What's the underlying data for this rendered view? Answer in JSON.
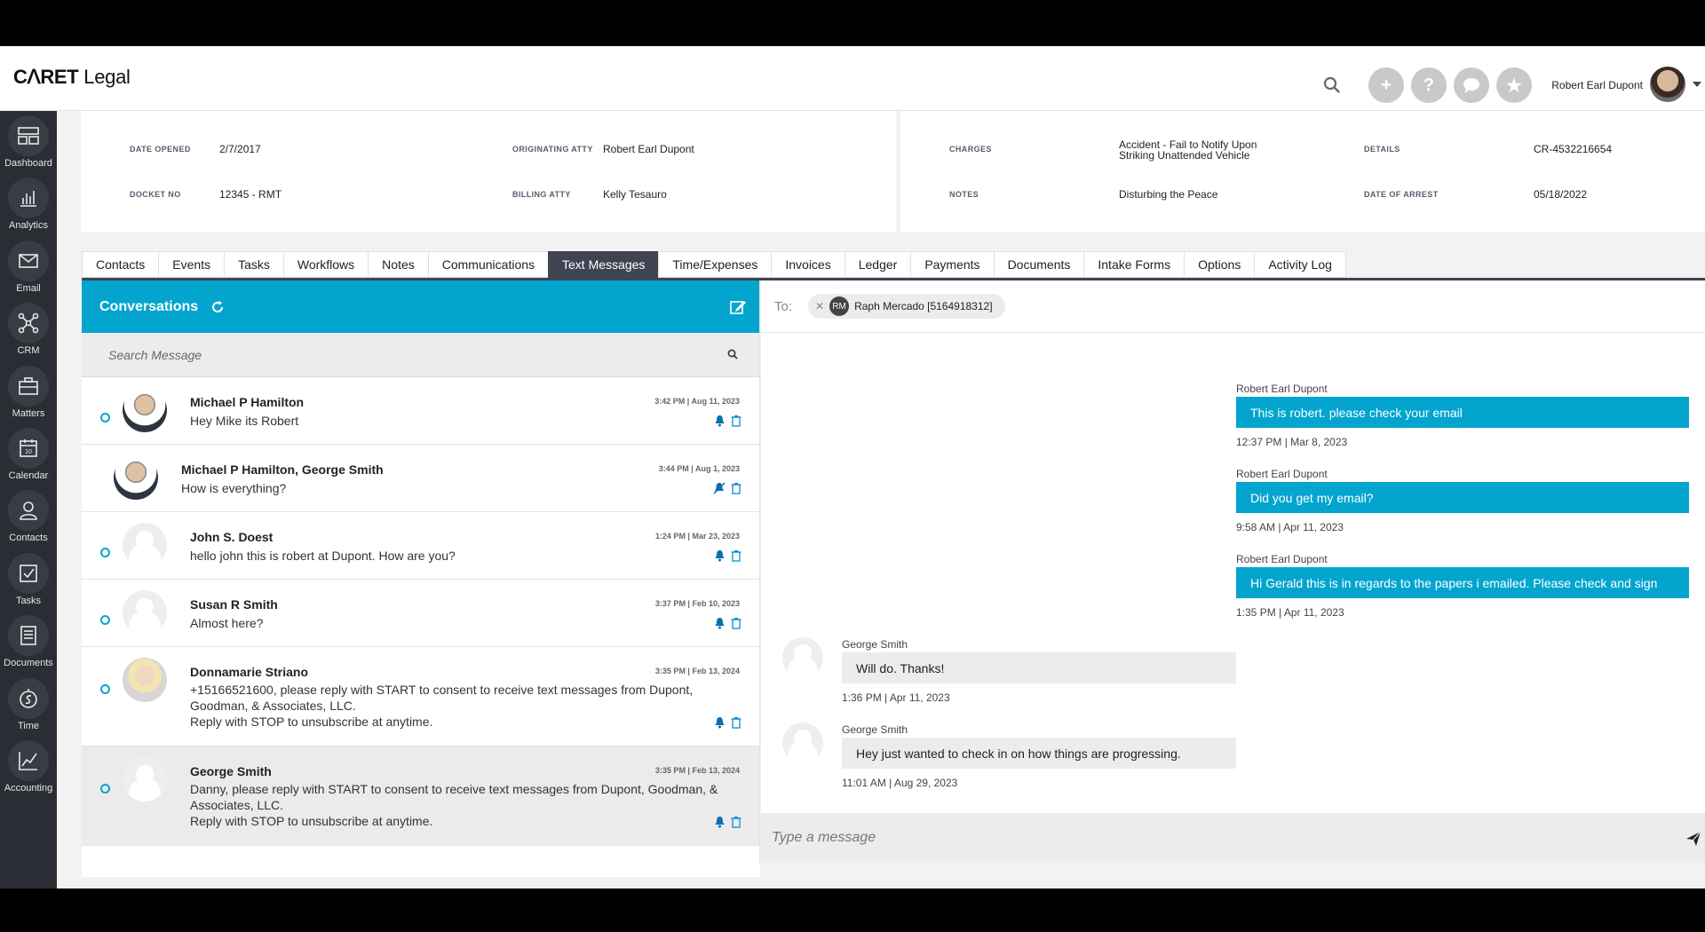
{
  "app": {
    "logo_prefix": "CᐱRET",
    "logo_suffix": "Legal",
    "user_name": "Robert Earl Dupont"
  },
  "header_icons": {
    "add": "+",
    "help": "?",
    "chat": "chat-icon",
    "star": "★"
  },
  "sidebar": {
    "items": [
      {
        "label": "Dashboard",
        "icon": "dashboard-icon"
      },
      {
        "label": "Analytics",
        "icon": "analytics-icon"
      },
      {
        "label": "Email",
        "icon": "email-icon"
      },
      {
        "label": "CRM",
        "icon": "crm-icon"
      },
      {
        "label": "Matters",
        "icon": "matters-icon"
      },
      {
        "label": "Calendar",
        "icon": "calendar-icon"
      },
      {
        "label": "Contacts",
        "icon": "contacts-icon"
      },
      {
        "label": "Tasks",
        "icon": "tasks-icon"
      },
      {
        "label": "Documents",
        "icon": "documents-icon"
      },
      {
        "label": "Time",
        "icon": "time-icon"
      },
      {
        "label": "Accounting",
        "icon": "accounting-icon"
      }
    ],
    "calendar_day": "10"
  },
  "matter": {
    "date_opened_label": "DATE OPENED",
    "date_opened": "2/7/2017",
    "originating_atty_label": "ORIGINATING ATTY",
    "originating_atty": "Robert Earl Dupont",
    "docket_no_label": "DOCKET NO",
    "docket_no": "12345 - RMT",
    "billing_atty_label": "BILLING ATTY",
    "billing_atty": "Kelly Tesauro",
    "charges_label": "CHARGES",
    "charges_line1": "Accident - Fail to Notify Upon",
    "charges_line2": "Striking Unattended Vehicle",
    "details_label": "DETAILS",
    "details": "CR-4532216654",
    "notes_label": "NOTES",
    "notes": "Disturbing the Peace",
    "date_of_arrest_label": "DATE OF ARREST",
    "date_of_arrest": "05/18/2022"
  },
  "tabs": [
    "Contacts",
    "Events",
    "Tasks",
    "Workflows",
    "Notes",
    "Communications",
    "Text Messages",
    "Time/Expenses",
    "Invoices",
    "Ledger",
    "Payments",
    "Documents",
    "Intake Forms",
    "Options",
    "Activity Log"
  ],
  "active_tab": "Text Messages",
  "conversations": {
    "title": "Conversations",
    "search_placeholder": "Search Message",
    "items": [
      {
        "name": "Michael P Hamilton",
        "time": "3:42 PM | Aug 11, 2023",
        "msg1": "Hey Mike its Robert",
        "msg2": "",
        "msg3": ""
      },
      {
        "name": "Michael P Hamilton, George Smith",
        "time": "3:44 PM | Aug 1, 2023",
        "msg1": "How is everything?",
        "msg2": "",
        "msg3": ""
      },
      {
        "name": "John S. Doest",
        "time": "1:24 PM | Mar 23, 2023",
        "msg1": "hello john this is robert at Dupont. How are you?",
        "msg2": "",
        "msg3": ""
      },
      {
        "name": "Susan R Smith",
        "time": "3:37 PM | Feb 10, 2023",
        "msg1": "Almost here?",
        "msg2": "",
        "msg3": ""
      },
      {
        "name": "Donnamarie Striano",
        "time": "3:35 PM | Feb 13, 2024",
        "msg1": "+15166521600, please reply with START to consent to receive text messages from Dupont,",
        "msg2": "Goodman, & Associates, LLC.",
        "msg3": "Reply with STOP to unsubscribe at anytime."
      },
      {
        "name": "George Smith",
        "time": "3:35 PM | Feb 13, 2024",
        "msg1": "Danny, please reply with START to consent to receive text messages from Dupont, Goodman, &",
        "msg2": "Associates, LLC.",
        "msg3": "Reply with STOP to unsubscribe at anytime."
      }
    ]
  },
  "chat": {
    "to_label": "To:",
    "recipient_initials": "RM",
    "recipient": "Raph Mercado [5164918312]",
    "messages": [
      {
        "sender": "Robert Earl Dupont",
        "text": "This is robert. please check your email",
        "time": "12:37 PM | Mar 8, 2023"
      },
      {
        "sender": "Robert Earl Dupont",
        "text": "Did you get my email?",
        "time": "9:58 AM | Apr 11, 2023"
      },
      {
        "sender": "Robert Earl Dupont",
        "text": "Hi Gerald this is in regards to the papers i emailed. Please check and sign",
        "time": "1:35 PM | Apr 11, 2023"
      },
      {
        "sender": "George Smith",
        "text": "Will do. Thanks!",
        "time": "1:36 PM | Apr 11, 2023"
      },
      {
        "sender": "George Smith",
        "text": "Hey just wanted to check in on how things are progressing.",
        "time": "11:01 AM | Aug 29, 2023"
      }
    ],
    "compose_placeholder": "Type a message"
  },
  "colors": {
    "accent": "#03a5cf",
    "sidebar_bg": "#2b2d34",
    "active_tab": "#3e4451"
  }
}
